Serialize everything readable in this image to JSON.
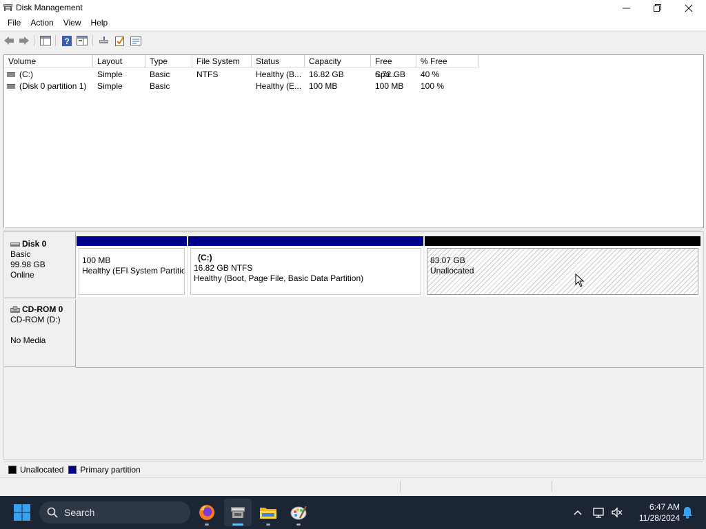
{
  "window": {
    "title": "Disk Management"
  },
  "menu": [
    "File",
    "Action",
    "View",
    "Help"
  ],
  "volume_list": {
    "columns": [
      "Volume",
      "Layout",
      "Type",
      "File System",
      "Status",
      "Capacity",
      "Free Spa...",
      "% Free"
    ],
    "rows": [
      [
        "(C:)",
        "Simple",
        "Basic",
        "NTFS",
        "Healthy (B...",
        "16.82 GB",
        "6.72 GB",
        "40 %"
      ],
      [
        "(Disk 0 partition 1)",
        "Simple",
        "Basic",
        "",
        "Healthy (E...",
        "100 MB",
        "100 MB",
        "100 %"
      ]
    ]
  },
  "disk0": {
    "name": "Disk 0",
    "type": "Basic",
    "size": "99.98 GB",
    "state": "Online",
    "partitions": [
      {
        "name": "",
        "size": "100 MB",
        "desc": "Healthy (EFI System Partitio",
        "bar_color": "#00008b"
      },
      {
        "name": "(C:)",
        "size": "16.82 GB NTFS",
        "desc": "Healthy (Boot, Page File, Basic Data Partition)",
        "bar_color": "#00008b"
      },
      {
        "name": "",
        "size": "83.07 GB",
        "desc": "Unallocated",
        "bar_color": "#000000"
      }
    ]
  },
  "cdrom0": {
    "name": "CD-ROM 0",
    "drive": "CD-ROM (D:)",
    "media": "No Media"
  },
  "legend": [
    {
      "label": "Unallocated",
      "color": "#000000"
    },
    {
      "label": "Primary partition",
      "color": "#00008b"
    }
  ],
  "taskbar": {
    "search_placeholder": "Search",
    "time": "6:47 AM",
    "date": "11/28/2024"
  }
}
